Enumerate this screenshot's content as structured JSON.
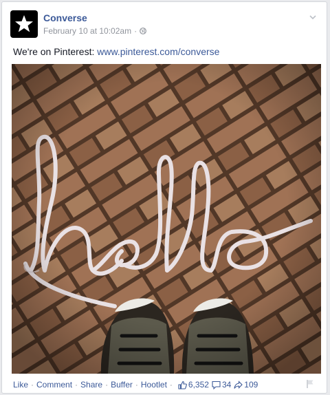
{
  "post": {
    "page_name": "Converse",
    "timestamp": "February 10 at 10:02am",
    "dot": "·",
    "text_prefix": "We're on Pinterest: ",
    "link_text": "www.pinterest.com/converse",
    "photo_word": "hello"
  },
  "footer": {
    "like": "Like",
    "comment": "Comment",
    "share": "Share",
    "buffer": "Buffer",
    "hootlet": "Hootlet",
    "sep": "·",
    "likes_count": "6,352",
    "comments_count": "34",
    "shares_count": "109"
  },
  "colors": {
    "link": "#3b5998",
    "meta": "#90949c",
    "text": "#141823"
  },
  "icons": {
    "avatar": "star-icon",
    "privacy": "globe-icon",
    "options": "chevron-down-icon",
    "likes": "thumbs-up-icon",
    "comments": "comment-icon",
    "shares": "share-arrow-icon",
    "report": "flag-icon"
  }
}
